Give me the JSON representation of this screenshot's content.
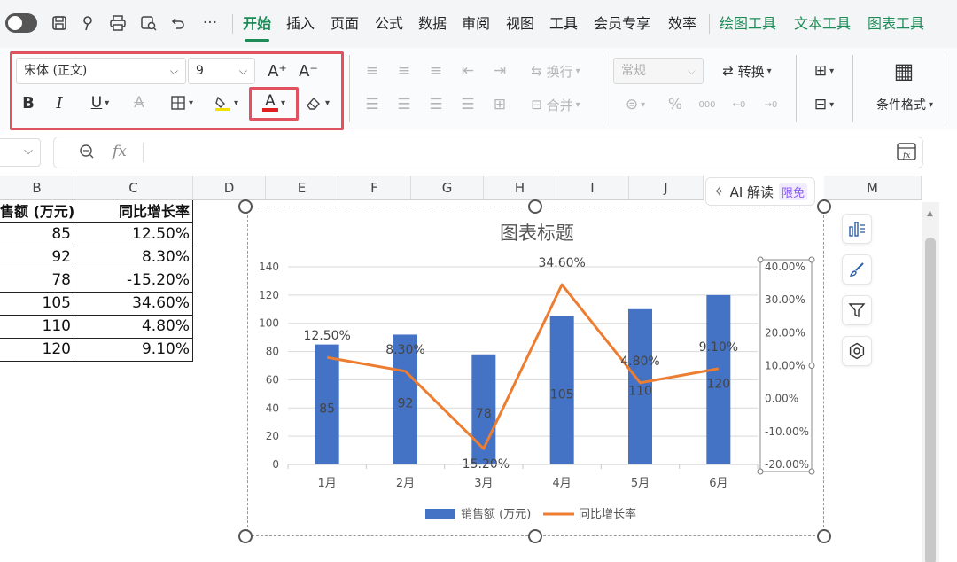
{
  "quick_access": {
    "icons": [
      "save-icon",
      "format-painter-icon",
      "print-icon",
      "print-preview-icon",
      "undo-icon",
      "more-icon"
    ],
    "more_label": "···"
  },
  "tabs": [
    {
      "label": "开始",
      "active": true
    },
    {
      "label": "插入"
    },
    {
      "label": "页面"
    },
    {
      "label": "公式"
    },
    {
      "label": "数据"
    },
    {
      "label": "审阅"
    },
    {
      "label": "视图"
    },
    {
      "label": "工具"
    },
    {
      "label": "会员专享"
    },
    {
      "label": "效率"
    },
    {
      "label": "绘图工具",
      "contextual": true
    },
    {
      "label": "文本工具",
      "contextual": true
    },
    {
      "label": "图表工具",
      "contextual": true
    }
  ],
  "font": {
    "family": "宋体 (正文)",
    "size": "9",
    "increase_label": "A⁺",
    "decrease_label": "A⁻",
    "bold_label": "B",
    "italic_label": "I",
    "underline_label": "U",
    "strike_label": "A",
    "font_color_label": "A",
    "font_color": "#e02020",
    "highlight_color": "#f2e000"
  },
  "alignment": {
    "wrap_label": "换行",
    "merge_label": "合并"
  },
  "number": {
    "format": "常规",
    "convert_label": "转换",
    "percent_label": "%",
    "thousands_label": "000"
  },
  "styles": {
    "conditional_label": "条件格式"
  },
  "formula_bar": {
    "fx_label": "fx",
    "value": ""
  },
  "columns": [
    "B",
    "C",
    "D",
    "E",
    "F",
    "G",
    "H",
    "I",
    "J",
    "M"
  ],
  "sheet": {
    "header": [
      "售额 (万元)",
      "同比增长率"
    ],
    "rows": [
      [
        "85",
        "12.50%"
      ],
      [
        "92",
        "8.30%"
      ],
      [
        "78",
        "-15.20%"
      ],
      [
        "105",
        "34.60%"
      ],
      [
        "110",
        "4.80%"
      ],
      [
        "120",
        "9.10%"
      ]
    ]
  },
  "ai_button": {
    "label": "AI 解读",
    "badge": "限免"
  },
  "chart_data": {
    "type": "bar",
    "title": "图表标题",
    "categories": [
      "1月",
      "2月",
      "3月",
      "4月",
      "5月",
      "6月"
    ],
    "series": [
      {
        "name": "销售额 (万元)",
        "type": "bar",
        "axis": "left",
        "color": "#4472c4",
        "values": [
          85,
          92,
          78,
          105,
          110,
          120
        ],
        "labels": [
          "85",
          "92",
          "78",
          "105",
          "110",
          "120"
        ]
      },
      {
        "name": "同比增长率",
        "type": "line",
        "axis": "right",
        "color": "#ed7d31",
        "values": [
          12.5,
          8.3,
          -15.2,
          34.6,
          4.8,
          9.1
        ],
        "labels": [
          "12.50%",
          "8.30%",
          "-15.20%",
          "34.60%",
          "4.80%",
          "9.10%"
        ]
      }
    ],
    "ylim": [
      0,
      140
    ],
    "yticks": [
      "0",
      "20",
      "40",
      "60",
      "80",
      "100",
      "120",
      "140"
    ],
    "y2lim": [
      -20,
      40
    ],
    "y2ticks": [
      "-20.00%",
      "-10.00%",
      "0.00%",
      "10.00%",
      "20.00%",
      "30.00%",
      "40.00%"
    ],
    "grid": true,
    "legend": "bottom"
  }
}
